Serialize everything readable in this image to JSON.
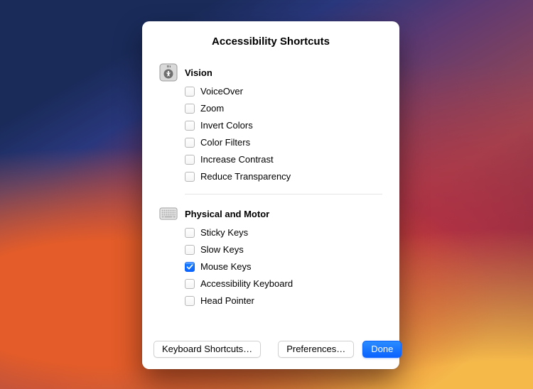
{
  "title": "Accessibility Shortcuts",
  "sections": [
    {
      "id": "vision",
      "title": "Vision",
      "icon": "accessibility-icon",
      "options": [
        {
          "id": "voiceover",
          "label": "VoiceOver",
          "checked": false
        },
        {
          "id": "zoom",
          "label": "Zoom",
          "checked": false
        },
        {
          "id": "invert-colors",
          "label": "Invert Colors",
          "checked": false
        },
        {
          "id": "color-filters",
          "label": "Color Filters",
          "checked": false
        },
        {
          "id": "increase-contrast",
          "label": "Increase Contrast",
          "checked": false
        },
        {
          "id": "reduce-transparency",
          "label": "Reduce Transparency",
          "checked": false
        }
      ]
    },
    {
      "id": "physical-motor",
      "title": "Physical and Motor",
      "icon": "keyboard-icon",
      "options": [
        {
          "id": "sticky-keys",
          "label": "Sticky Keys",
          "checked": false
        },
        {
          "id": "slow-keys",
          "label": "Slow Keys",
          "checked": false
        },
        {
          "id": "mouse-keys",
          "label": "Mouse Keys",
          "checked": true
        },
        {
          "id": "accessibility-keyboard",
          "label": "Accessibility Keyboard",
          "checked": false
        },
        {
          "id": "head-pointer",
          "label": "Head Pointer",
          "checked": false
        }
      ]
    }
  ],
  "footer": {
    "keyboard_shortcuts": "Keyboard Shortcuts…",
    "preferences": "Preferences…",
    "done": "Done"
  },
  "colors": {
    "accent": "#0a63ff"
  }
}
